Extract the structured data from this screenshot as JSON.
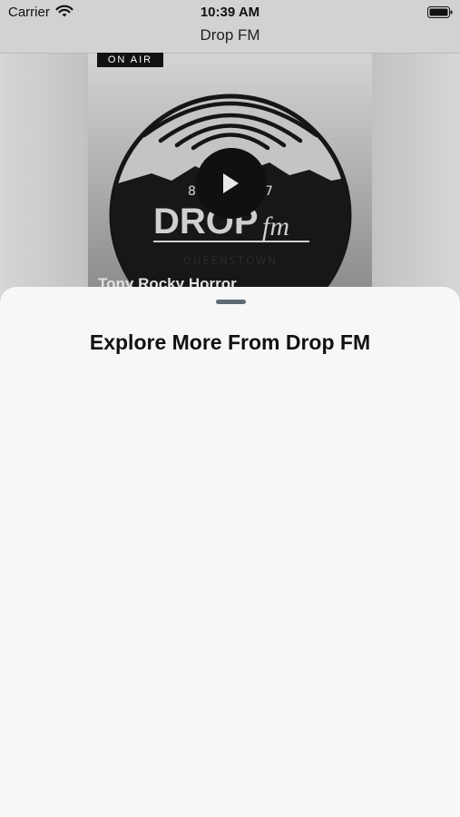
{
  "status_bar": {
    "carrier": "Carrier",
    "time": "10:39 AM",
    "wifi_icon": "wifi-icon",
    "battery_icon": "battery-icon"
  },
  "nav": {
    "title": "Drop FM"
  },
  "player": {
    "badge": "ON AIR",
    "logo": {
      "frequency_left": "8",
      "frequency_right": "7",
      "brand_main": "DROP",
      "brand_suffix": "fm",
      "location": "QUEENSTOWN"
    },
    "play_icon": "play-icon",
    "show_title": "Tony Rocky Horror"
  },
  "sheet": {
    "title": "Explore More From Drop FM"
  },
  "colors": {
    "dim_background": "#d2d2d2",
    "sheet_background": "#f7f7f7",
    "grabber": "#5e6a74",
    "badge_background": "#111111"
  }
}
